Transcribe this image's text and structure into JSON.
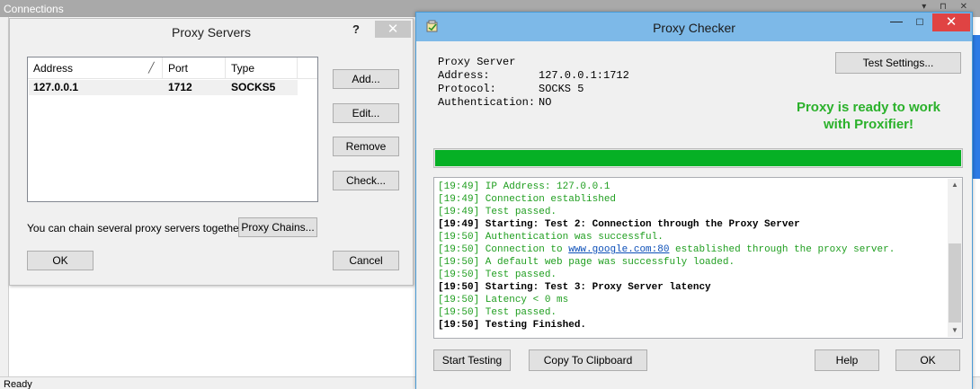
{
  "background_window": {
    "title": "Connections",
    "status": "Ready"
  },
  "proxy_servers": {
    "title": "Proxy Servers",
    "help_label": "?",
    "close_label": "✕",
    "columns": [
      "Address",
      "Port",
      "Type"
    ],
    "sort_glyph": "╱",
    "rows": [
      {
        "address": "127.0.0.1",
        "port": "1712",
        "type": "SOCKS5"
      }
    ],
    "buttons": {
      "add": "Add...",
      "edit": "Edit...",
      "remove": "Remove",
      "check": "Check...",
      "proxy_chains": "Proxy Chains...",
      "ok": "OK",
      "cancel": "Cancel"
    },
    "chain_text": "You can chain several proxy servers together:"
  },
  "proxy_checker": {
    "title": "Proxy Checker",
    "minimize_label": "—",
    "maximize_label": "☐",
    "close_label": "✕",
    "info": {
      "heading": "Proxy Server",
      "address_label": "Address:",
      "address_value": "127.0.0.1:1712",
      "protocol_label": "Protocol:",
      "protocol_value": "SOCKS 5",
      "auth_label": "Authentication:",
      "auth_value": "NO"
    },
    "test_settings_label": "Test Settings...",
    "ready_line1": "Proxy is ready to work",
    "ready_line2": "with Proxifier!",
    "progress": 1.0,
    "log": [
      {
        "text": "[19:49] IP Address: 127.0.0.1",
        "style": "green"
      },
      {
        "text": "[19:49] Connection established",
        "style": "green"
      },
      {
        "text": "[19:49] Test passed.",
        "style": "green"
      },
      {
        "text": "[19:49] Starting: Test 2: Connection through the Proxy Server",
        "style": "black"
      },
      {
        "text": "[19:50] Authentication was successful.",
        "style": "green"
      },
      {
        "text_before": "[19:50] Connection to ",
        "link": "www.google.com:80",
        "text_after": " established through the proxy server.",
        "style": "green"
      },
      {
        "text": "[19:50] A default web page was successfuly loaded.",
        "style": "green"
      },
      {
        "text": "[19:50] Test passed.",
        "style": "green"
      },
      {
        "text": "[19:50] Starting: Test 3: Proxy Server latency",
        "style": "black"
      },
      {
        "text": "[19:50] Latency < 0 ms",
        "style": "green"
      },
      {
        "text": "[19:50] Test passed.",
        "style": "green"
      },
      {
        "text": "[19:50] Testing Finished.",
        "style": "black"
      }
    ],
    "buttons": {
      "start_testing": "Start Testing",
      "copy_clipboard": "Copy To Clipboard",
      "help": "Help",
      "ok": "OK"
    },
    "colors": {
      "success_text": "#2bb12b",
      "progress_fill": "#06b025",
      "titlebar": "#7db9e8",
      "close_button": "#e04343"
    }
  }
}
